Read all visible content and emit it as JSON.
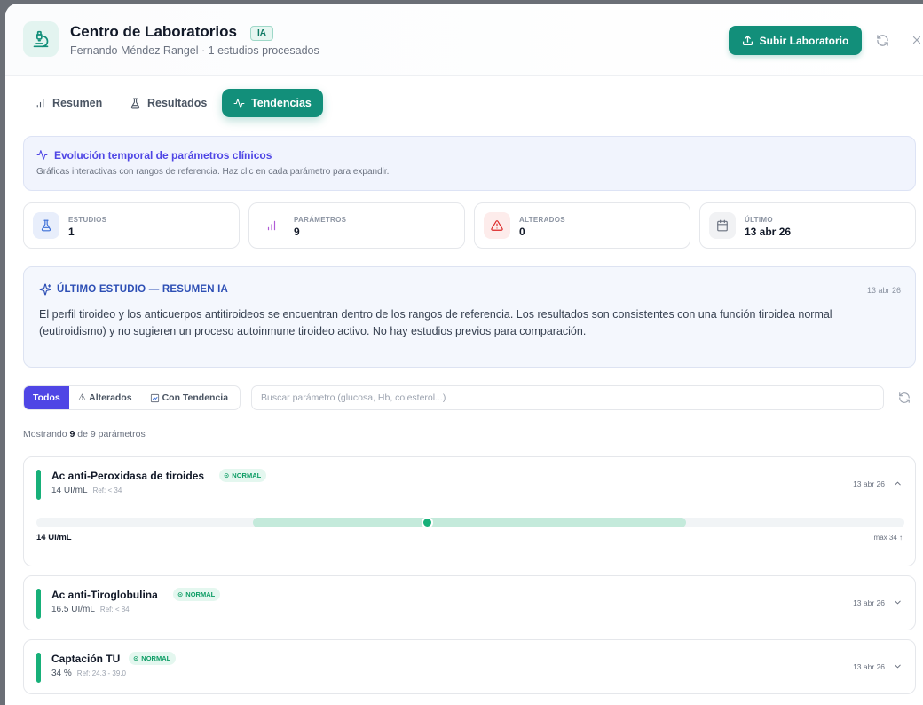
{
  "header": {
    "title": "Centro de Laboratorios",
    "badge": "IA",
    "subtitle": "Fernando Méndez Rangel · 1 estudios procesados",
    "upload_label": "Subir Laboratorio"
  },
  "tabs": [
    {
      "label": "Resumen"
    },
    {
      "label": "Resultados"
    },
    {
      "label": "Tendencias"
    }
  ],
  "banner": {
    "title": "Evolución temporal de parámetros clínicos",
    "description": "Gráficas interactivas con rangos de referencia. Haz clic en cada parámetro para expandir."
  },
  "stats": [
    {
      "label": "ESTUDIOS",
      "value": "1"
    },
    {
      "label": "PARÁMETROS",
      "value": "9"
    },
    {
      "label": "ALTERADOS",
      "value": "0"
    },
    {
      "label": "ÚLTIMO",
      "value": "13 abr 26"
    }
  ],
  "summary": {
    "title": "ÚLTIMO ESTUDIO — RESUMEN IA",
    "date": "13 abr 26",
    "text": "El perfil tiroideo y los anticuerpos antitiroideos se encuentran dentro de los rangos de referencia. Los resultados son consistentes con una función tiroidea normal (eutiroidismo) y no sugieren un proceso autoinmune tiroideo activo. No hay estudios previos para comparación."
  },
  "filters": {
    "all": "Todos",
    "altered": "Alterados",
    "trend": "Con Tendencia",
    "search_placeholder": "Buscar parámetro (glucosa, Hb, colesterol...)"
  },
  "count": {
    "prefix": "Mostrando",
    "shown": "9",
    "suffix": "de 9 parámetros"
  },
  "parameters": [
    {
      "name": "Ac anti-Peroxidasa de tiroides",
      "status": "NORMAL",
      "value": "14 UI/mL",
      "ref": "Ref: < 34",
      "date": "13 abr 26",
      "expanded": true,
      "range_value_label": "14 UI/mL",
      "range_max_label": "máx 34 ↑",
      "range_fraction": 0.45
    },
    {
      "name": "Ac anti-Tiroglobulina",
      "status": "NORMAL",
      "value": "16.5 UI/mL",
      "ref": "Ref: < 84",
      "date": "13 abr 26",
      "expanded": false
    },
    {
      "name": "Captación TU",
      "status": "NORMAL",
      "value": "34 %",
      "ref": "Ref: 24.3 - 39.0",
      "date": "13 abr 26",
      "expanded": false
    }
  ],
  "colors": {
    "accent": "#128f7a",
    "indigo": "#4f46e5",
    "normal": "#17b079"
  }
}
